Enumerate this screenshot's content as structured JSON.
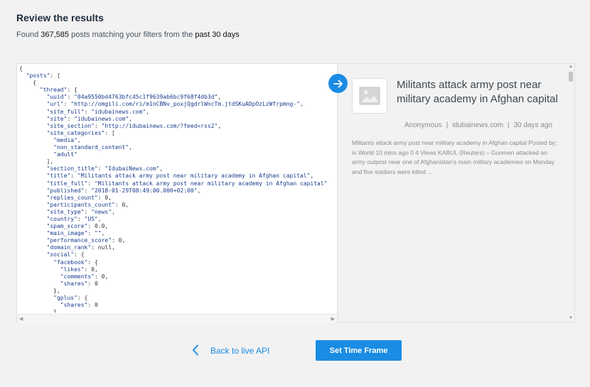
{
  "header": {
    "title": "Review the results",
    "found_prefix": "Found",
    "count": "367,585",
    "found_middle": "posts matching your filters from the",
    "period": "past 30 days"
  },
  "json_lines": [
    [
      {
        "t": "{"
      }
    ],
    [
      {
        "t": "  "
      },
      {
        "t": "\"posts\"",
        "c": "k"
      },
      {
        "t": ": ["
      }
    ],
    [
      {
        "t": "    {"
      }
    ],
    [
      {
        "t": "      "
      },
      {
        "t": "\"thread\"",
        "c": "k"
      },
      {
        "t": ": {"
      }
    ],
    [
      {
        "t": "        "
      },
      {
        "t": "\"uuid\"",
        "c": "k"
      },
      {
        "t": ": "
      },
      {
        "t": "\"04a9550bd4763bfc45c1f9639ab6bc9f68f4db3d\"",
        "c": "s"
      },
      {
        "t": ","
      }
    ],
    [
      {
        "t": "        "
      },
      {
        "t": "\"url\"",
        "c": "k"
      },
      {
        "t": ": "
      },
      {
        "t": "\"http://omgili.com/ri/m1nCBNv_poxjQgdrlWncTm.jtdSKuADpOzLzWfrpmng-\"",
        "c": "s"
      },
      {
        "t": ","
      }
    ],
    [
      {
        "t": "        "
      },
      {
        "t": "\"site_full\"",
        "c": "k"
      },
      {
        "t": ": "
      },
      {
        "t": "\"idubainews.com\"",
        "c": "s"
      },
      {
        "t": ","
      }
    ],
    [
      {
        "t": "        "
      },
      {
        "t": "\"site\"",
        "c": "k"
      },
      {
        "t": ": "
      },
      {
        "t": "\"idubainews.com\"",
        "c": "s"
      },
      {
        "t": ","
      }
    ],
    [
      {
        "t": "        "
      },
      {
        "t": "\"site_section\"",
        "c": "k"
      },
      {
        "t": ": "
      },
      {
        "t": "\"http://idubainews.com/?feed=rss2\"",
        "c": "s"
      },
      {
        "t": ","
      }
    ],
    [
      {
        "t": "        "
      },
      {
        "t": "\"site_categories\"",
        "c": "k"
      },
      {
        "t": ": ["
      }
    ],
    [
      {
        "t": "          "
      },
      {
        "t": "\"media\"",
        "c": "s"
      },
      {
        "t": ","
      }
    ],
    [
      {
        "t": "          "
      },
      {
        "t": "\"non_standard_content\"",
        "c": "s"
      },
      {
        "t": ","
      }
    ],
    [
      {
        "t": "          "
      },
      {
        "t": "\"adult\"",
        "c": "s"
      }
    ],
    [
      {
        "t": "        ],"
      }
    ],
    [
      {
        "t": "        "
      },
      {
        "t": "\"section_title\"",
        "c": "k"
      },
      {
        "t": ": "
      },
      {
        "t": "\"IdubaiNews.com\"",
        "c": "s"
      },
      {
        "t": ","
      }
    ],
    [
      {
        "t": "        "
      },
      {
        "t": "\"title\"",
        "c": "k"
      },
      {
        "t": ": "
      },
      {
        "t": "\"Militants attack army post near military academy in Afghan capital\"",
        "c": "s"
      },
      {
        "t": ","
      }
    ],
    [
      {
        "t": "        "
      },
      {
        "t": "\"title_full\"",
        "c": "k"
      },
      {
        "t": ": "
      },
      {
        "t": "\"Militants attack army post near military academy in Afghan capital\"",
        "c": "s"
      }
    ],
    [
      {
        "t": "        "
      },
      {
        "t": "\"published\"",
        "c": "k"
      },
      {
        "t": ": "
      },
      {
        "t": "\"2018-01-29T08:49:00.000+02:00\"",
        "c": "s"
      },
      {
        "t": ","
      }
    ],
    [
      {
        "t": "        "
      },
      {
        "t": "\"replies_count\"",
        "c": "k"
      },
      {
        "t": ": 0,"
      }
    ],
    [
      {
        "t": "        "
      },
      {
        "t": "\"participants_count\"",
        "c": "k"
      },
      {
        "t": ": 0,"
      }
    ],
    [
      {
        "t": "        "
      },
      {
        "t": "\"site_type\"",
        "c": "k"
      },
      {
        "t": ": "
      },
      {
        "t": "\"news\"",
        "c": "s"
      },
      {
        "t": ","
      }
    ],
    [
      {
        "t": "        "
      },
      {
        "t": "\"country\"",
        "c": "k"
      },
      {
        "t": ": "
      },
      {
        "t": "\"US\"",
        "c": "s"
      },
      {
        "t": ","
      }
    ],
    [
      {
        "t": "        "
      },
      {
        "t": "\"spam_score\"",
        "c": "k"
      },
      {
        "t": ": 0.0,"
      }
    ],
    [
      {
        "t": "        "
      },
      {
        "t": "\"main_image\"",
        "c": "k"
      },
      {
        "t": ": "
      },
      {
        "t": "\"\"",
        "c": "s"
      },
      {
        "t": ","
      }
    ],
    [
      {
        "t": "        "
      },
      {
        "t": "\"performance_score\"",
        "c": "k"
      },
      {
        "t": ": 0,"
      }
    ],
    [
      {
        "t": "        "
      },
      {
        "t": "\"domain_rank\"",
        "c": "k"
      },
      {
        "t": ": null,"
      }
    ],
    [
      {
        "t": "        "
      },
      {
        "t": "\"social\"",
        "c": "k"
      },
      {
        "t": ": {"
      }
    ],
    [
      {
        "t": "          "
      },
      {
        "t": "\"facebook\"",
        "c": "k"
      },
      {
        "t": ": {"
      }
    ],
    [
      {
        "t": "            "
      },
      {
        "t": "\"likes\"",
        "c": "k"
      },
      {
        "t": ": 0,"
      }
    ],
    [
      {
        "t": "            "
      },
      {
        "t": "\"comments\"",
        "c": "k"
      },
      {
        "t": ": 0,"
      }
    ],
    [
      {
        "t": "            "
      },
      {
        "t": "\"shares\"",
        "c": "k"
      },
      {
        "t": ": 0"
      }
    ],
    [
      {
        "t": "          },"
      }
    ],
    [
      {
        "t": "          "
      },
      {
        "t": "\"gplus\"",
        "c": "k"
      },
      {
        "t": ": {"
      }
    ],
    [
      {
        "t": "            "
      },
      {
        "t": "\"shares\"",
        "c": "k"
      },
      {
        "t": ": 0"
      }
    ],
    [
      {
        "t": "          },"
      }
    ]
  ],
  "preview": {
    "title": "Militants attack army post near military academy in Afghan capital",
    "author": "Anonymous",
    "site": "idubainews.com",
    "time": "30 days ago",
    "body": "Militants attack army post near military academy in Afghan capital Posted by: in World 10 mins ago 0 4 Views KABUL (Reuters) – Gunmen attacked an army outpost near one of Afghanistan's main military academies on Monday and five soldiers were killed ..."
  },
  "icons": {
    "go": "arrow-right-icon",
    "image": "image-placeholder-icon",
    "back": "chevron-left-icon"
  },
  "footer": {
    "back_label": "Back to live API",
    "set_time_label": "Set Time Frame"
  },
  "colors": {
    "accent": "#1b8ce3",
    "background": "#f2f2f2",
    "json_key": "#1a3d8f"
  }
}
